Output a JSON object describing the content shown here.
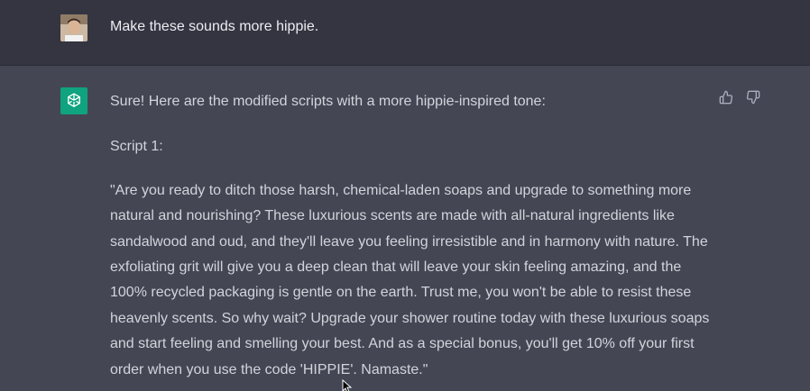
{
  "user_message": {
    "text": "Make these sounds more hippie."
  },
  "assistant_message": {
    "intro": "Sure! Here are the modified scripts with a more hippie-inspired tone:",
    "script_heading": "Script 1:",
    "script_body": "\"Are you ready to ditch those harsh, chemical-laden soaps and upgrade to something more natural and nourishing? These luxurious scents are made with all-natural ingredients like sandalwood and oud, and they'll leave you feeling irresistible and in harmony with nature. The exfoliating grit will give you a deep clean that will leave your skin feeling amazing, and the 100% recycled packaging is gentle on the earth. Trust me, you won't be able to resist these heavenly scents. So why wait? Upgrade your shower routine today with these luxurious soaps and start feeling and smelling your best. And as a special bonus, you'll get 10% off your first order when you use the code 'HIPPIE'. Namaste.\""
  },
  "icons": {
    "user_avatar": "user-avatar",
    "assistant_logo": "openai-logo-icon",
    "thumbs_up": "thumbs-up-icon",
    "thumbs_down": "thumbs-down-icon"
  },
  "colors": {
    "user_bg": "#343541",
    "assistant_bg": "#444654",
    "logo_bg": "#10a37f",
    "text": "#d1d5db"
  }
}
